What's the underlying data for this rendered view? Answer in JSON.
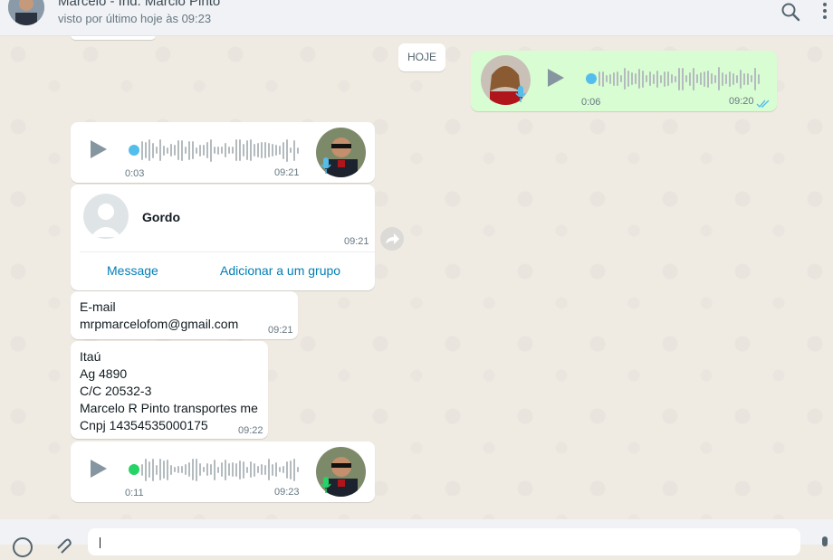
{
  "header": {
    "contact_name": "Marcelo - Ind. Marcio Pinto",
    "status": "visto por último hoje às 09:23"
  },
  "date_chip": "HOJE",
  "messages": {
    "voice_out": {
      "duration": "0:06",
      "time": "09:20",
      "progress": 0
    },
    "voice_in_1": {
      "duration": "0:03",
      "time": "09:21",
      "progress": 0
    },
    "contact_card": {
      "name": "Gordo",
      "time": "09:21",
      "action_message": "Message",
      "action_add_group": "Adicionar a um grupo"
    },
    "email_msg": {
      "line1": "E-mail",
      "line2": "mrpmarcelofom@gmail.com",
      "time": "09:21"
    },
    "bank_msg": {
      "line1": "Itaú",
      "line2": "Ag 4890",
      "line3": "C/C 20532-3",
      "line4": "Marcelo R Pinto transportes me",
      "line5": "Cnpj 14354535000175",
      "time": "09:22"
    },
    "voice_in_2": {
      "duration": "0:11",
      "time": "09:23",
      "progress": 0
    }
  },
  "colors": {
    "accent_blue": "#53bdeb",
    "unplayed_green": "#25d366",
    "outgoing_bubble": "#d9fdd3",
    "read_tick": "#53bdeb"
  },
  "icons": {
    "search": "search-icon",
    "menu": "kebab-menu-icon",
    "play": "play-icon",
    "mic": "mic-icon",
    "forward": "forward-icon",
    "emoji": "emoji-icon",
    "attach": "attach-icon",
    "double_tick": "double-tick-icon"
  }
}
